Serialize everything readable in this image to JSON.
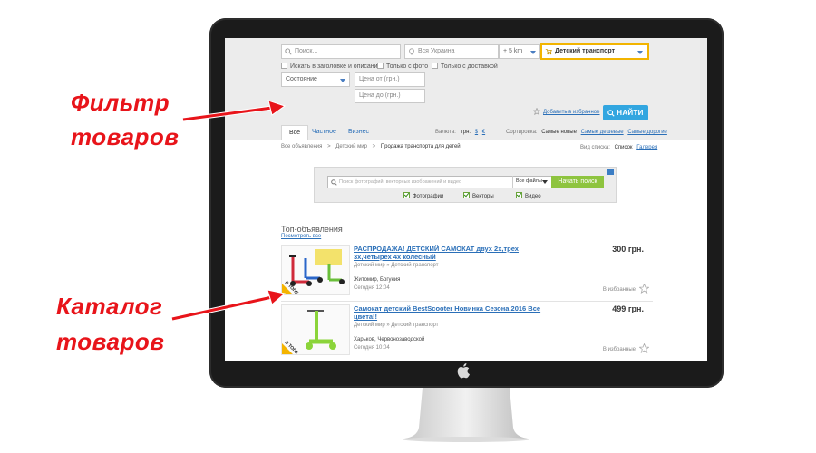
{
  "annotations": {
    "filter_label_line1": "Фильтр",
    "filter_label_line2": "товаров",
    "catalog_label_line1": "Каталог",
    "catalog_label_line2": "товаров",
    "color": "#e8141a"
  },
  "search": {
    "query_placeholder": "Поиск...",
    "region_value": "Вся Украина",
    "radius_value": "+ 5 km",
    "category_value": "Детский транспорт",
    "checkbox_title_only": "Искать в заголовке и описании",
    "checkbox_photo_only": "Только с фото",
    "checkbox_delivery_only": "Только с доставкой",
    "condition_value": "Состояние",
    "price_from_placeholder": "Цена от (грн.)",
    "price_to_placeholder": "Цена до (грн.)",
    "save_favorites_label": "Добавить в избранное",
    "find_button_label": "НАЙТИ"
  },
  "tabs": [
    {
      "label": "Все",
      "active": true
    },
    {
      "label": "Частное",
      "active": false
    },
    {
      "label": "Бизнес",
      "active": false
    }
  ],
  "currency": {
    "label": "Валюта:",
    "uah": "грн.",
    "usd": "$",
    "eur": "€"
  },
  "sorting": {
    "label": "Сортировка:",
    "options": [
      "Самые новые",
      "Самые дешевые",
      "Самые дорогие"
    ]
  },
  "breadcrumb": [
    "Все объявления",
    "Детский мир",
    "Продажа транспорта для детей"
  ],
  "view_mode": {
    "label": "Вид списка:",
    "current": "Список",
    "other": "Галерея"
  },
  "ad_banner": {
    "search_placeholder": "Поиск фотографий, векторных изображений и видео",
    "files_label": "Все файлы",
    "button_label": "Начать поиск",
    "options": [
      "Фотографии",
      "Векторы",
      "Видео"
    ],
    "button_color": "#8ec43f"
  },
  "catalog": {
    "heading": "Топ-объявления",
    "see_all_label": "Посмотреть все",
    "items": [
      {
        "title": "РАСПРОДАЖА! ДЕТСКИЙ САМОКАТ двух 2х,трех 3х,четырех 4х колесный",
        "category": "Детский мир » Детский транспорт",
        "location": "Житомир, Богуния",
        "date": "Сегодня 12:04",
        "price": "300 грн.",
        "fav_label": "В избранные",
        "badge": "В ТОПЕ"
      },
      {
        "title": "Самокат детский BestScooter Новинка Сезона 2016 Все цвета!!",
        "category": "Детский мир » Детский транспорт",
        "location": "Харьков, Червонозаводской",
        "date": "Сегодня 10:04",
        "price": "499 грн.",
        "fav_label": "В избранные",
        "badge": "В ТОПЕ"
      }
    ]
  },
  "colors": {
    "accent": "#32a6e0",
    "link": "#2a6fb8",
    "category_border": "#f2b400"
  }
}
